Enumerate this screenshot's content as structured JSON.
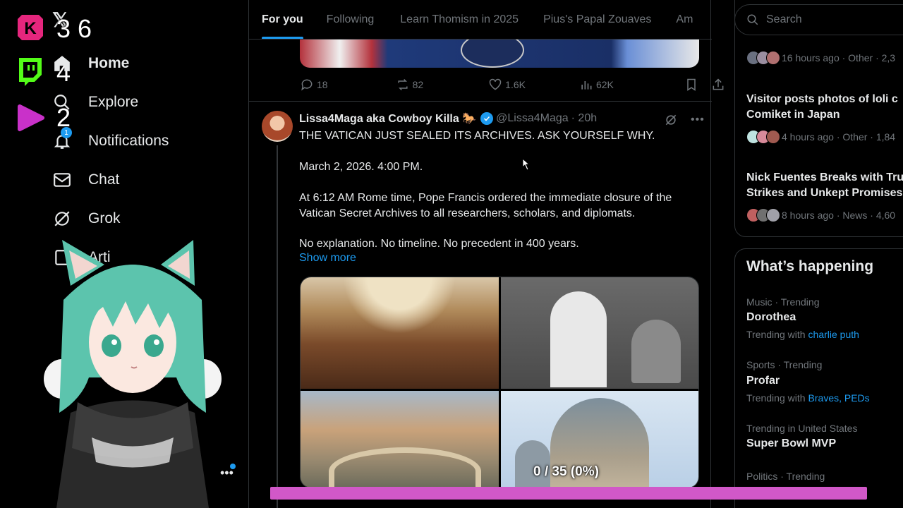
{
  "x_logo": "𝕏",
  "stream_overlay": {
    "kick": {
      "icon": "kick-icon",
      "count": "3",
      "color": "#e5267d"
    },
    "twitch": {
      "icon": "twitch-icon",
      "count": "4",
      "color": "#53fc18"
    },
    "youtube": {
      "icon": "youtube-icon",
      "count": "2",
      "color": "#c931c9"
    },
    "total": "6",
    "progress_text": "0 / 35 (0%)",
    "progress_fraction": 0
  },
  "nav": {
    "items": [
      {
        "label": "Home",
        "icon": "home-icon"
      },
      {
        "label": "Explore",
        "icon": "search-icon"
      },
      {
        "label": "Notifications",
        "icon": "bell-icon",
        "badge": "1"
      },
      {
        "label": "Chat",
        "icon": "envelope-icon"
      },
      {
        "label": "Grok",
        "icon": "grok-icon"
      },
      {
        "label": "Arti",
        "icon": "article-icon"
      }
    ]
  },
  "tabs": [
    "For you",
    "Following",
    "Learn Thomism in 2025",
    "Pius's Papal Zouaves",
    "Am"
  ],
  "prev_tweet": {
    "replies": "18",
    "reposts": "82",
    "likes": "1.6K",
    "views": "62K"
  },
  "tweet": {
    "name": "Lissa4Maga aka Cowboy Killa 🐎",
    "handle": "@Lissa4Maga",
    "time": "· 20h",
    "lines": [
      "THE VATICAN JUST SEALED ITS ARCHIVES. ASK YOURSELF WHY.",
      "March 2, 2026. 4:00 PM.",
      "At 6:12 AM Rome time, Pope Francis ordered the immediate closure of the",
      "Vatican Secret Archives to all researchers, scholars, and diplomats.",
      "No explanation. No timeline. No precedent in 400 years."
    ],
    "show_more": "Show more"
  },
  "search": {
    "placeholder": "Search"
  },
  "news": [
    {
      "title_lines": [],
      "meta": "16 hours ago · Other · 2,3"
    },
    {
      "title_lines": [
        "Visitor posts photos of loli c",
        "Comiket in Japan"
      ],
      "meta": "4 hours ago · Other · 1,84"
    },
    {
      "title_lines": [
        "Nick Fuentes Breaks with Tru",
        "Strikes and Unkept Promises"
      ],
      "meta": "8 hours ago · News · 4,60"
    }
  ],
  "whats_happening": {
    "title": "What’s happening",
    "trends": [
      {
        "category": "Music · Trending",
        "name": "Dorothea",
        "with_label": "Trending with",
        "with_links": "charlie puth"
      },
      {
        "category": "Sports · Trending",
        "name": "Profar",
        "with_label": "Trending with",
        "with_links": "Braves, PEDs"
      },
      {
        "category": "Trending in United States",
        "name": "Super Bowl MVP",
        "with_label": "",
        "with_links": ""
      },
      {
        "category": "Politics · Trending",
        "name": "",
        "with_label": "",
        "with_links": ""
      }
    ]
  },
  "colors": {
    "accent": "#1d9bf0",
    "progress": "#d158c8",
    "background": "#000000"
  }
}
